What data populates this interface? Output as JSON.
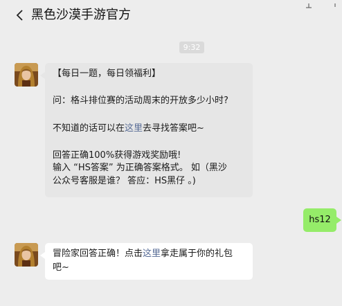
{
  "header": {
    "title": "黑色沙漠手游官方"
  },
  "chat": {
    "timestamp": "9:32",
    "msg1": {
      "line1": "【每日一题，每日领福利】",
      "line2": "问：格斗排位赛的活动周末的开放多少小时?",
      "line3_before": "不知道的话可以在",
      "line3_link": "这里",
      "line3_after": "去寻找答案吧~",
      "line4": "回答正确100%获得游戏奖励哦!",
      "line5": "输入 “HS答案” 为正确答案格式。 如（黑沙",
      "line6": "公众号客服是谁？ 答应：HS黑仔 。)"
    },
    "reply": {
      "text": "hs12"
    },
    "msg2": {
      "before": "冒险家回答正确！点击",
      "link": "这里",
      "after": "拿走属于你的礼包",
      "line2": "吧~"
    }
  },
  "colors": {
    "background": "#ededed",
    "self_bubble": "#95ec69",
    "link": "#576b95"
  }
}
